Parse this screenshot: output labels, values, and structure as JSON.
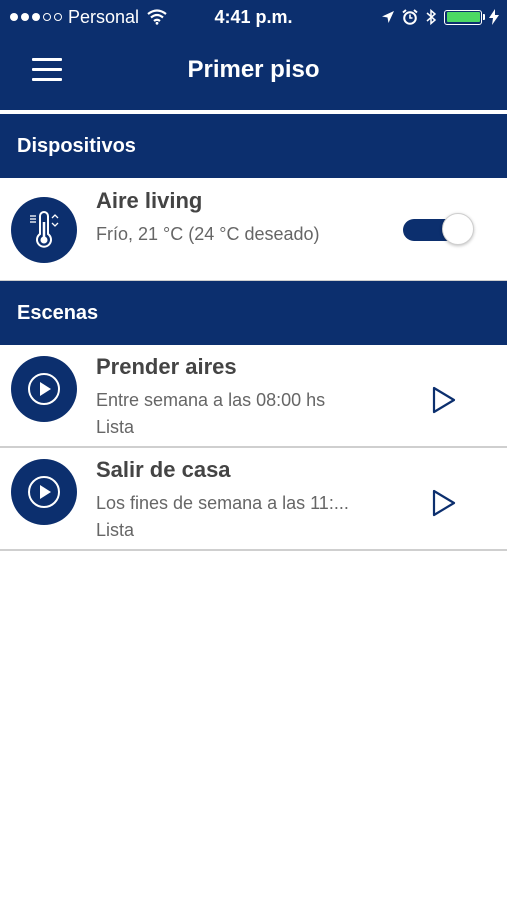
{
  "statusbar": {
    "carrier": "Personal",
    "time": "4:41 p.m.",
    "signal_icon": "signal-dots-icon",
    "wifi_icon": "wifi-icon",
    "location_icon": "location-arrow-icon",
    "alarm_icon": "alarm-clock-icon",
    "bluetooth_icon": "bluetooth-icon",
    "battery_icon": "battery-icon",
    "charging_icon": "charging-bolt-icon"
  },
  "navbar": {
    "title": "Primer piso",
    "menu_icon": "hamburger-menu-icon"
  },
  "sections": {
    "devices_header": "Dispositivos",
    "scenes_header": "Escenas"
  },
  "devices": [
    {
      "name": "Aire living",
      "status": "Frío, 21 °C (24 °C deseado)",
      "icon": "thermometer-icon",
      "toggle_on": true
    }
  ],
  "scenes": [
    {
      "name": "Prender aires",
      "schedule": "Entre semana a las 08:00 hs",
      "state": "Lista",
      "icon": "play-circle-icon",
      "action_icon": "play-icon"
    },
    {
      "name": "Salir de casa",
      "schedule": "Los fines de semana a las 11:...",
      "state": "Lista",
      "icon": "play-circle-icon",
      "action_icon": "play-icon"
    }
  ],
  "colors": {
    "brand_navy": "#0c2f6e",
    "battery_green": "#4cd964",
    "divider_gray": "#cfcfcf"
  }
}
